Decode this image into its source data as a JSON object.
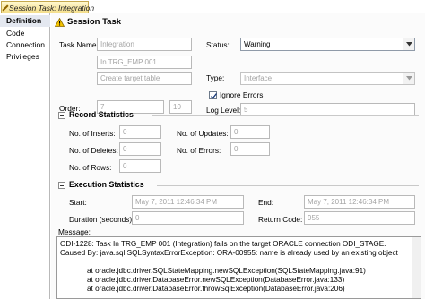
{
  "tab": {
    "title": "Session Task: Integration"
  },
  "sidebar": {
    "items": [
      {
        "label": "Definition",
        "active": true
      },
      {
        "label": "Code"
      },
      {
        "label": "Connection"
      },
      {
        "label": "Privileges"
      }
    ]
  },
  "header": {
    "title": "Session Task"
  },
  "definition": {
    "task_name_label": "Task Name:",
    "task_name_value": "Integration",
    "task_line2": "In TRG_EMP 001",
    "task_line3": "Create target table",
    "order_label": "Order:",
    "order_value": "7",
    "order_value2": "10",
    "status_label": "Status:",
    "status_value": "Warning",
    "type_label": "Type:",
    "type_value": "Interface",
    "ignore_errors_label": "Ignore Errors",
    "ignore_errors_checked": true,
    "log_level_label": "Log Level:",
    "log_level_value": "5"
  },
  "record_stats": {
    "title": "Record Statistics",
    "inserts_label": "No. of Inserts:",
    "inserts_value": "0",
    "updates_label": "No. of Updates:",
    "updates_value": "0",
    "deletes_label": "No. of Deletes:",
    "deletes_value": "0",
    "errors_label": "No. of Errors:",
    "errors_value": "0",
    "rows_label": "No. of Rows:",
    "rows_value": "0"
  },
  "exec_stats": {
    "title": "Execution Statistics",
    "start_label": "Start:",
    "start_value": "May 7, 2011 12:46:34 PM",
    "end_label": "End:",
    "end_value": "May 7, 2011 12:46:34 PM",
    "duration_label": "Duration (seconds):",
    "duration_value": "0",
    "return_code_label": "Return Code:",
    "return_code_value": "955"
  },
  "message": {
    "label": "Message:",
    "lines": [
      "ODI-1228: Task In TRG_EMP 001 (Integration) fails on the target ORACLE connection ODI_STAGE.",
      "Caused By: java.sql.SQLSyntaxErrorException: ORA-00955: name is already used by an existing object",
      "",
      "at oracle.jdbc.driver.SQLStateMapping.newSQLException(SQLStateMapping.java:91)",
      "at oracle.jdbc.driver.DatabaseError.newSQLException(DatabaseError.java:133)",
      "at oracle.jdbc.driver.DatabaseError.throwSqlException(DatabaseError.java:206)"
    ]
  },
  "colors": {
    "tab_gradient_top": "#fff8cf",
    "tab_gradient_bottom": "#f3dc86",
    "warning_icon": "#f5c400",
    "sidebar_active": "#e4e8f0",
    "field_text_disabled": "#a4a4a4"
  },
  "icons": {
    "tab_icon": "task-diamond-icon",
    "header_icon": "warning-triangle-icon"
  }
}
